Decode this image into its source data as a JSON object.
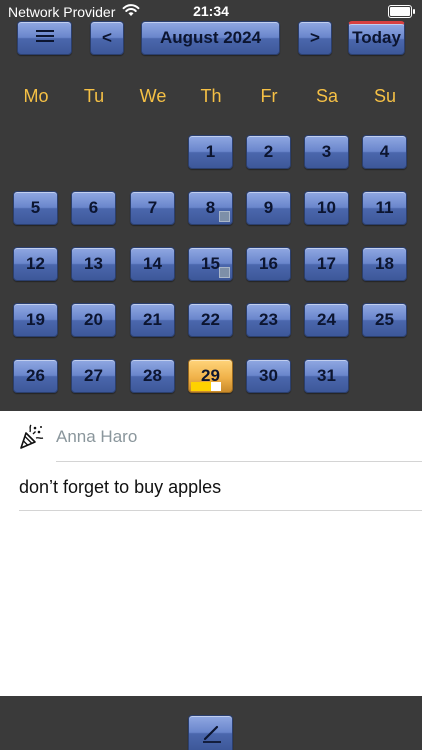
{
  "status_bar": {
    "carrier": "Network Provider",
    "time": "21:34"
  },
  "toolbar": {
    "prev_label": "<",
    "month_label": "August 2024",
    "next_label": ">",
    "today_label": "Today"
  },
  "calendar": {
    "weekdays": [
      "Mo",
      "Tu",
      "We",
      "Th",
      "Fr",
      "Sa",
      "Su"
    ],
    "days": [
      "1",
      "2",
      "3",
      "4",
      "5",
      "6",
      "7",
      "8",
      "9",
      "10",
      "11",
      "12",
      "13",
      "14",
      "15",
      "16",
      "17",
      "18",
      "19",
      "20",
      "21",
      "22",
      "23",
      "24",
      "25",
      "26",
      "27",
      "28",
      "29",
      "30",
      "31"
    ],
    "selected_day": "29",
    "days_with_entries": [
      "8",
      "15"
    ]
  },
  "entry": {
    "author": "Anna Haro",
    "note": "don’t forget to buy apples"
  },
  "colors": {
    "background": "#3a3a3a",
    "weekday_text": "#f5c045",
    "button_blue": "#6a86cc",
    "today_highlight": "#f0b24a"
  }
}
